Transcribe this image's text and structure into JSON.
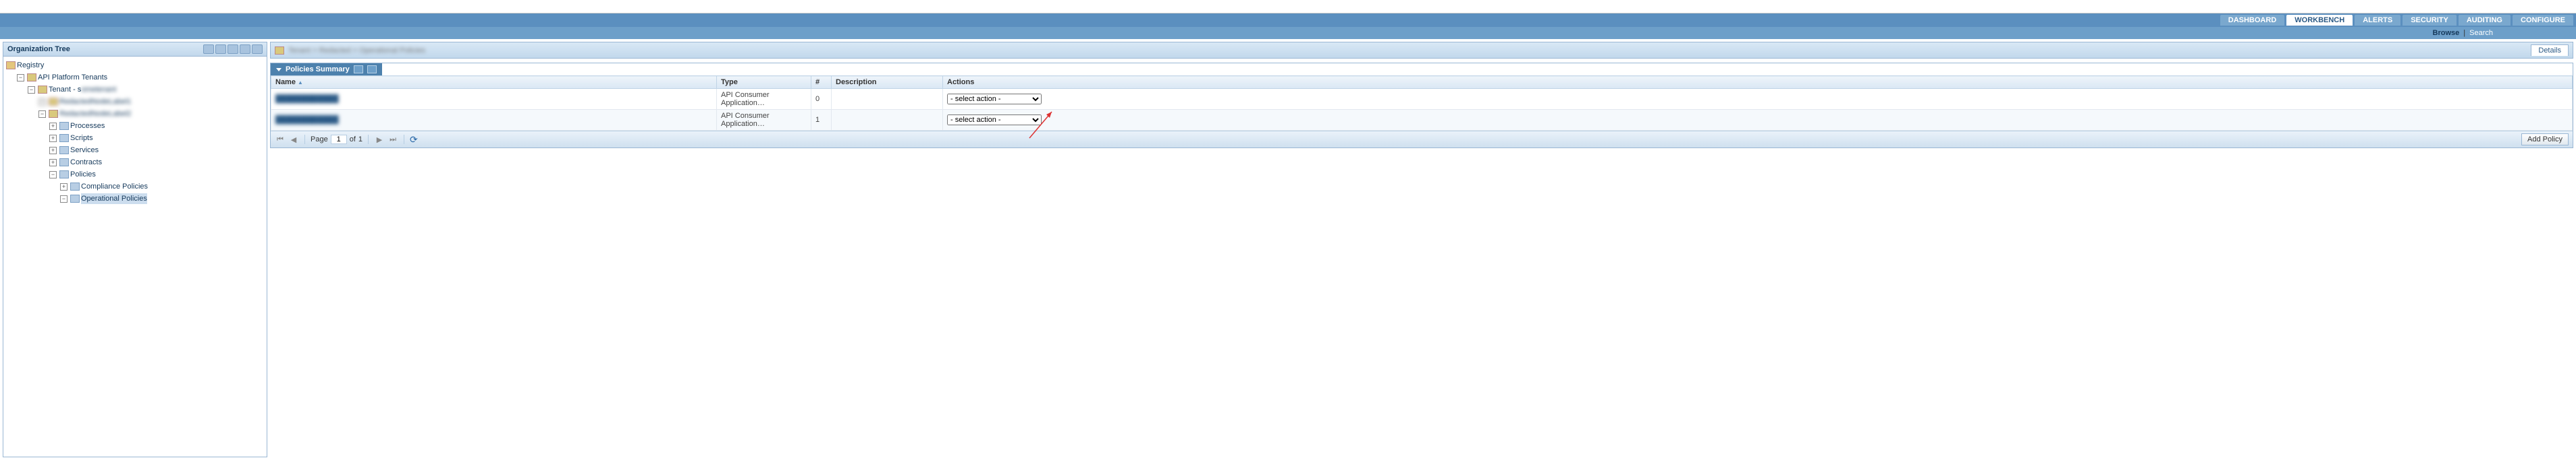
{
  "nav": {
    "tabs": [
      {
        "label": "DASHBOARD",
        "active": false
      },
      {
        "label": "WORKBENCH",
        "active": true
      },
      {
        "label": "ALERTS",
        "active": false
      },
      {
        "label": "SECURITY",
        "active": false
      },
      {
        "label": "AUDITING",
        "active": false
      },
      {
        "label": "CONFIGURE",
        "active": false
      }
    ],
    "browse": "Browse",
    "search": "Search"
  },
  "sidebar": {
    "title": "Organization Tree",
    "root": "Registry",
    "tenants": "API Platform Tenants",
    "tenant_prefix": "Tenant - s",
    "items": {
      "processes": "Processes",
      "scripts": "Scripts",
      "services": "Services",
      "contracts": "Contracts",
      "policies": "Policies",
      "compliance": "Compliance Policies",
      "operational": "Operational Policies"
    }
  },
  "main": {
    "details_tab": "Details",
    "panel_title": "Policies Summary",
    "columns": {
      "name": "Name",
      "type": "Type",
      "count": "#",
      "description": "Description",
      "actions": "Actions"
    },
    "rows": [
      {
        "name": "████████████",
        "type": "API Consumer Application…",
        "count": "0",
        "description": "",
        "action": "- select action -"
      },
      {
        "name": "████████████",
        "type": "API Consumer Application…",
        "count": "1",
        "description": "",
        "action": "- select action -"
      }
    ],
    "pager": {
      "page_label": "Page",
      "page_value": "1",
      "of_label": "of",
      "total": "1"
    },
    "add_policy": "Add Policy"
  }
}
